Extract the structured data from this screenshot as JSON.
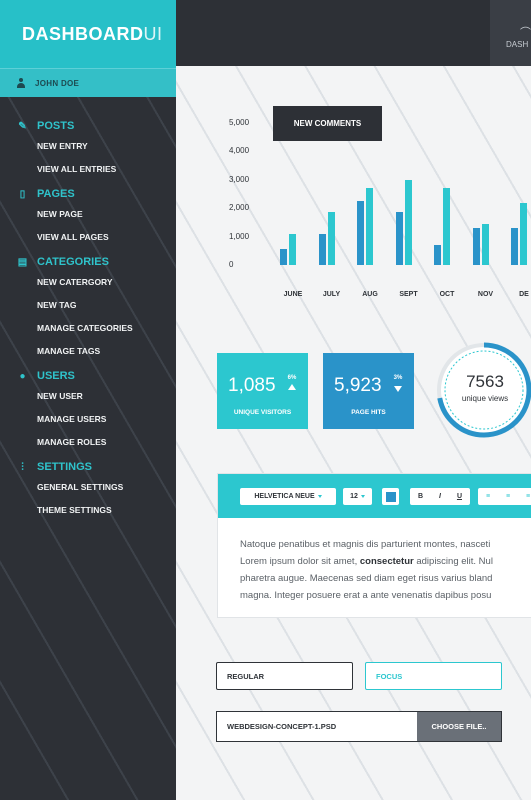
{
  "brand": {
    "bold": "DASHBOARD",
    "light": "UI"
  },
  "user": {
    "name": "JOHN DOE"
  },
  "sidebar": [
    {
      "icon": "pencil-icon",
      "label": "POSTS",
      "items": [
        "NEW ENTRY",
        "VIEW ALL ENTRIES"
      ]
    },
    {
      "icon": "page-icon",
      "label": "PAGES",
      "items": [
        "NEW PAGE",
        "VIEW ALL PAGES"
      ]
    },
    {
      "icon": "categories-icon",
      "label": "CATEGORIES",
      "items": [
        "NEW CATERGORY",
        "NEW TAG",
        "MANAGE CATEGORIES",
        "MANAGE TAGS"
      ]
    },
    {
      "icon": "user-icon",
      "label": "USERS",
      "items": [
        "NEW USER",
        "MANAGE USERS",
        "MANAGE ROLES"
      ]
    },
    {
      "icon": "settings-icon",
      "label": "SETTINGS",
      "items": [
        "GENERAL SETTINGS",
        "THEME SETTINGS"
      ]
    }
  ],
  "topbar": {
    "tab_label": "DASH"
  },
  "chart_data": {
    "type": "bar",
    "categories": [
      "JUNE",
      "JULY",
      "AUG",
      "SEPT",
      "OCT",
      "NOV",
      "DE"
    ],
    "series": [
      {
        "values": [
          550,
          1100,
          2250,
          1850,
          700,
          1300,
          1300
        ]
      },
      {
        "values": [
          1100,
          1850,
          2700,
          3000,
          2700,
          1450,
          2200
        ]
      }
    ],
    "yticks": [
      "5,000",
      "4,000",
      "3,000",
      "2,000",
      "1,000",
      "0"
    ],
    "ylim": [
      0,
      5000
    ],
    "colors": [
      "#2a93c9",
      "#2cc7cf"
    ]
  },
  "chart_button": "NEW COMMENTS",
  "stats": [
    {
      "value": "1,085",
      "percent": "6%",
      "label": "UNIQUE VISITORS",
      "trend": "up"
    },
    {
      "value": "5,923",
      "percent": "3%",
      "label": "PAGE HITS",
      "trend": "down"
    }
  ],
  "gauge": {
    "value": "7563",
    "label": "unique views",
    "fraction": 0.72
  },
  "editor": {
    "font": "HELVETICA NEUE",
    "size": "12",
    "buttons": [
      "B",
      "I",
      "U"
    ],
    "lines": [
      "Natoque penatibus et magnis dis parturient montes, nasceti",
      "Lorem ipsum dolor sit amet, ",
      "pharetra augue. Maecenas sed diam eget risus varius bland",
      "magna. Integer posuere erat a ante venenatis dapibus posu"
    ],
    "bold_word": "consectetur",
    "line2_tail": " adipiscing elit. Nul"
  },
  "inputs": {
    "regular": "REGULAR",
    "focus": "FOCUS"
  },
  "file": {
    "name": "WEBDESIGN-CONCEPT-1.PSD",
    "button": "CHOOSE FILE.."
  }
}
